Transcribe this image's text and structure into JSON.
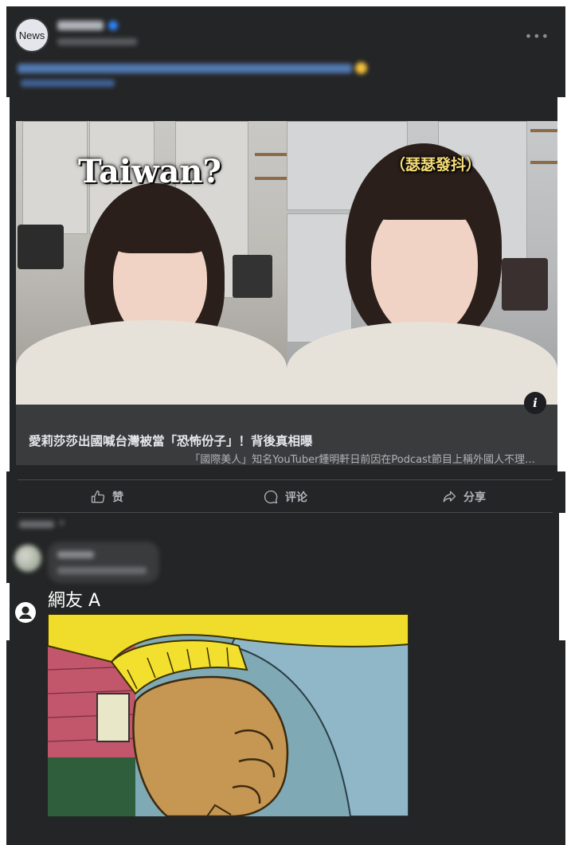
{
  "post": {
    "page_avatar_label": "News",
    "more_icon": "more-horizontal-icon"
  },
  "link_card": {
    "image_overlay_left": "Taiwan?",
    "image_overlay_right": "（瑟瑟發抖）",
    "title": "愛莉莎莎出國喊台灣被當「恐怖份子」！背後真相曝",
    "description": "「國際美人」知名YouTuber鍾明軒日前因在Podcast節目上稱外國人不理…",
    "info_icon": "info-icon"
  },
  "actions": {
    "like": "赞",
    "comment": "评论",
    "share": "分享"
  },
  "comments": {
    "reply_author": "網友 A"
  },
  "colors": {
    "background": "#242526",
    "card": "#3a3b3c",
    "text_primary": "#e4e6eb",
    "text_secondary": "#b0b3b8"
  }
}
